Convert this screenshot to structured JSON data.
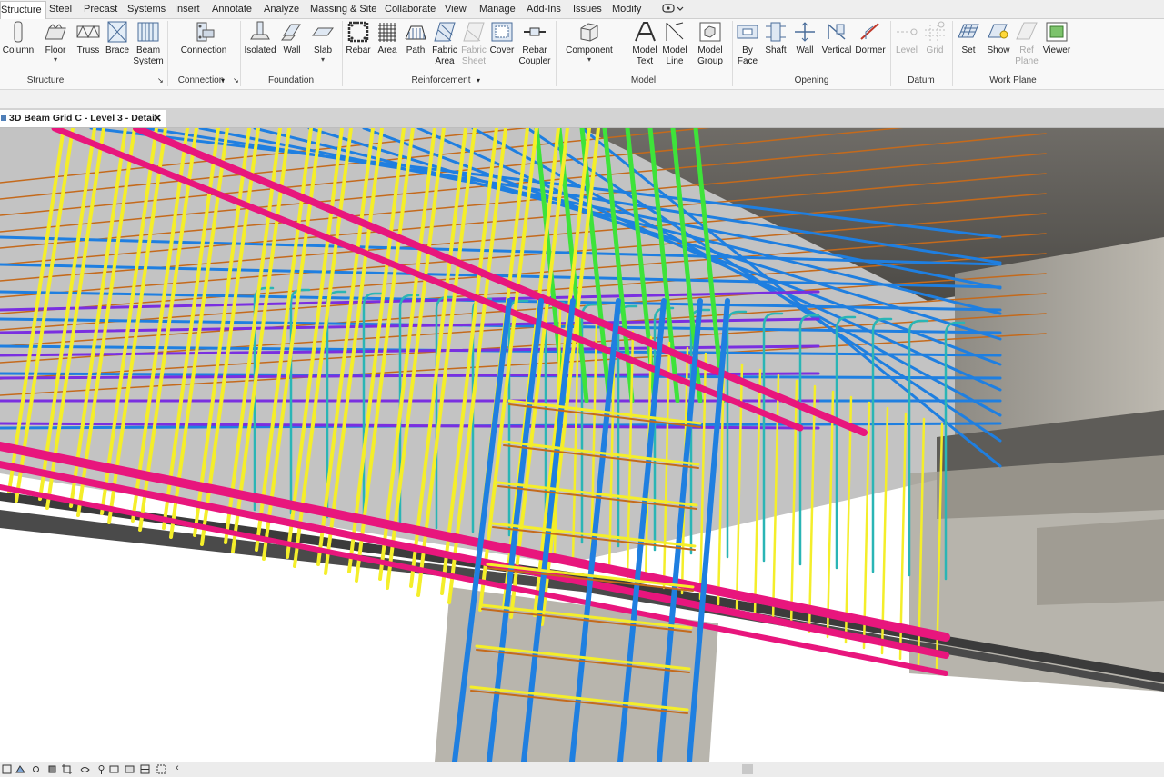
{
  "ribbon_tabs": [
    "Structure",
    "Steel",
    "Precast",
    "Systems",
    "Insert",
    "Annotate",
    "Analyze",
    "Massing & Site",
    "Collaborate",
    "View",
    "Manage",
    "Add-Ins",
    "Issues",
    "Modify"
  ],
  "active_tab": "Structure",
  "structure_panel": {
    "title": "Structure",
    "tools": [
      {
        "label": "Column",
        "icon": "column-icon"
      },
      {
        "label": "Floor",
        "icon": "floor-icon",
        "dropdown": true
      },
      {
        "label": "Truss",
        "icon": "truss-icon"
      },
      {
        "label": "Brace",
        "icon": "brace-icon"
      },
      {
        "label": "Beam System",
        "icon": "beam-system-icon"
      }
    ]
  },
  "connection_panel": {
    "title": "Connection",
    "tools": [
      {
        "label": "Connection",
        "icon": "connection-icon"
      }
    ]
  },
  "foundation_panel": {
    "title": "Foundation",
    "tools": [
      {
        "label": "Isolated",
        "icon": "isolated-foundation-icon"
      },
      {
        "label": "Wall",
        "icon": "wall-foundation-icon"
      },
      {
        "label": "Slab",
        "icon": "slab-icon",
        "dropdown": true
      }
    ]
  },
  "reinforcement_panel": {
    "title": "Reinforcement",
    "tools": [
      {
        "label": "Rebar",
        "icon": "rebar-icon"
      },
      {
        "label": "Area",
        "icon": "area-reinforcement-icon"
      },
      {
        "label": "Path",
        "icon": "path-reinforcement-icon"
      },
      {
        "label": "Fabric Area",
        "icon": "fabric-area-icon"
      },
      {
        "label": "Fabric Sheet",
        "icon": "fabric-sheet-icon",
        "disabled": true
      },
      {
        "label": "Cover",
        "icon": "cover-icon"
      },
      {
        "label": "Rebar Coupler",
        "icon": "rebar-coupler-icon"
      }
    ]
  },
  "model_panel": {
    "title": "Model",
    "tools": [
      {
        "label": "Component",
        "icon": "component-icon",
        "dropdown": true
      },
      {
        "label": "Model Text",
        "icon": "model-text-icon"
      },
      {
        "label": "Model Line",
        "icon": "model-line-icon"
      },
      {
        "label": "Model Group",
        "icon": "model-group-icon",
        "dropdown": true
      }
    ]
  },
  "opening_panel": {
    "title": "Opening",
    "tools": [
      {
        "label": "By Face",
        "icon": "by-face-icon"
      },
      {
        "label": "Shaft",
        "icon": "shaft-icon"
      },
      {
        "label": "Wall",
        "icon": "wall-opening-icon"
      },
      {
        "label": "Vertical",
        "icon": "vertical-opening-icon"
      },
      {
        "label": "Dormer",
        "icon": "dormer-icon"
      }
    ]
  },
  "datum_panel": {
    "title": "Datum",
    "tools": [
      {
        "label": "Level",
        "icon": "level-icon",
        "disabled": true
      },
      {
        "label": "Grid",
        "icon": "grid-icon",
        "disabled": true
      }
    ]
  },
  "workplane_panel": {
    "title": "Work Plane",
    "tools": [
      {
        "label": "Set",
        "icon": "set-workplane-icon"
      },
      {
        "label": "Show",
        "icon": "show-workplane-icon"
      },
      {
        "label": "Ref Plane",
        "icon": "ref-plane-icon",
        "disabled": true
      },
      {
        "label": "Viewer",
        "icon": "viewer-icon"
      }
    ]
  },
  "view_tab": {
    "title": "3D Beam Grid C - Level 3 - Detail",
    "close": "✕"
  },
  "colors": {
    "rebar_yellow": "#f4ee2a",
    "rebar_magenta": "#e8167d",
    "rebar_blue": "#1f7fe0",
    "rebar_green": "#3ee33a",
    "rebar_teal": "#2ab5b5",
    "rebar_purple": "#7a2fe0",
    "rebar_orange": "#c46a1c",
    "concrete": "#a9a59c"
  },
  "status_bar": {
    "icons": [
      "detail-level-icon",
      "visual-style-icon",
      "sun-path-icon",
      "shadows-icon",
      "crop-view-icon",
      "show-crop-icon",
      "unlock-3d-icon",
      "temporary-hide-icon",
      "reveal-hidden-icon",
      "worksharing-icon",
      "analysis-display-icon",
      "highlight-displacement-icon"
    ],
    "chevron": "‹"
  }
}
